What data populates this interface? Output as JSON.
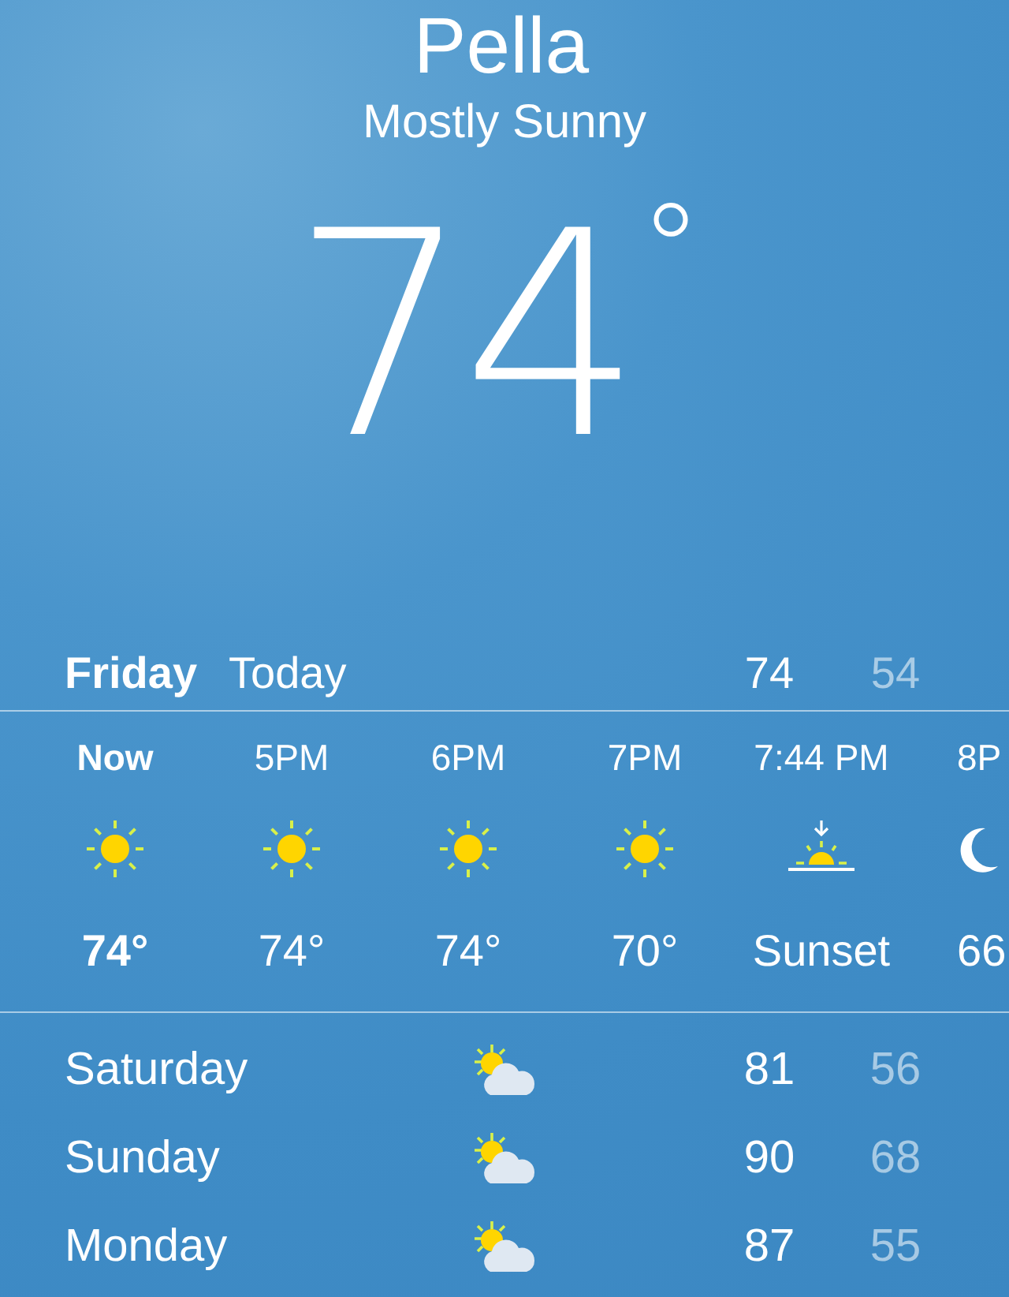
{
  "location": {
    "city": "Pella",
    "condition": "Mostly Sunny",
    "temperature": "74",
    "degree": "°"
  },
  "today": {
    "day": "Friday",
    "label": "Today",
    "high": "74",
    "low": "54"
  },
  "hourly": [
    {
      "time": "Now",
      "kind": "sun",
      "temp": "74°",
      "current": true
    },
    {
      "time": "5PM",
      "kind": "sun",
      "temp": "74°",
      "current": false
    },
    {
      "time": "6PM",
      "kind": "sun",
      "temp": "74°",
      "current": false
    },
    {
      "time": "7PM",
      "kind": "sun",
      "temp": "70°",
      "current": false
    },
    {
      "time": "7:44 PM",
      "kind": "sunset",
      "temp": "Sunset",
      "current": false
    },
    {
      "time": "8P",
      "kind": "moon",
      "temp": "66",
      "current": false
    }
  ],
  "daily": [
    {
      "day": "Saturday",
      "kind": "partly-cloudy",
      "high": "81",
      "low": "56"
    },
    {
      "day": "Sunday",
      "kind": "partly-cloudy",
      "high": "90",
      "low": "68"
    },
    {
      "day": "Monday",
      "kind": "partly-cloudy",
      "high": "87",
      "low": "55"
    }
  ]
}
